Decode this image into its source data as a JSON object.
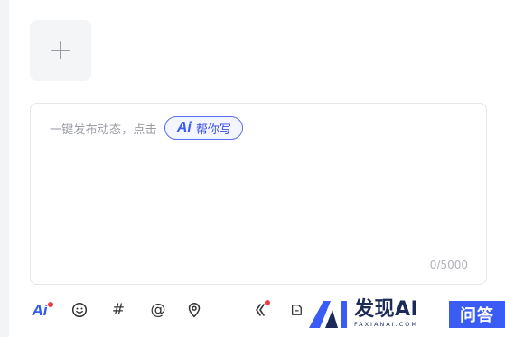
{
  "upload": {
    "add_icon": "plus-icon"
  },
  "composer": {
    "placeholder": "一键发布动态，点击",
    "ai_button": {
      "glyph": "Ai",
      "label": "帮你写"
    },
    "counter": "0/5000"
  },
  "toolbar": {
    "items": [
      {
        "name": "ai-assistant",
        "glyph": "Ai",
        "has_dot": true
      },
      {
        "name": "emoji",
        "icon": "smiley-icon"
      },
      {
        "name": "topic",
        "glyph": "#"
      },
      {
        "name": "mention",
        "glyph": "@"
      },
      {
        "name": "location",
        "icon": "location-pin-icon"
      },
      {
        "name": "link",
        "icon": "link-icon",
        "has_dot": true
      },
      {
        "name": "more",
        "icon": "document-icon"
      }
    ],
    "dot_color": "#f23a3a",
    "accent_color": "#2f5bf0"
  },
  "watermark": {
    "title": "发现AI",
    "subtitle": "FAXIANAI.COM",
    "badge": "问答",
    "brand_color": "#3a5cf5"
  }
}
